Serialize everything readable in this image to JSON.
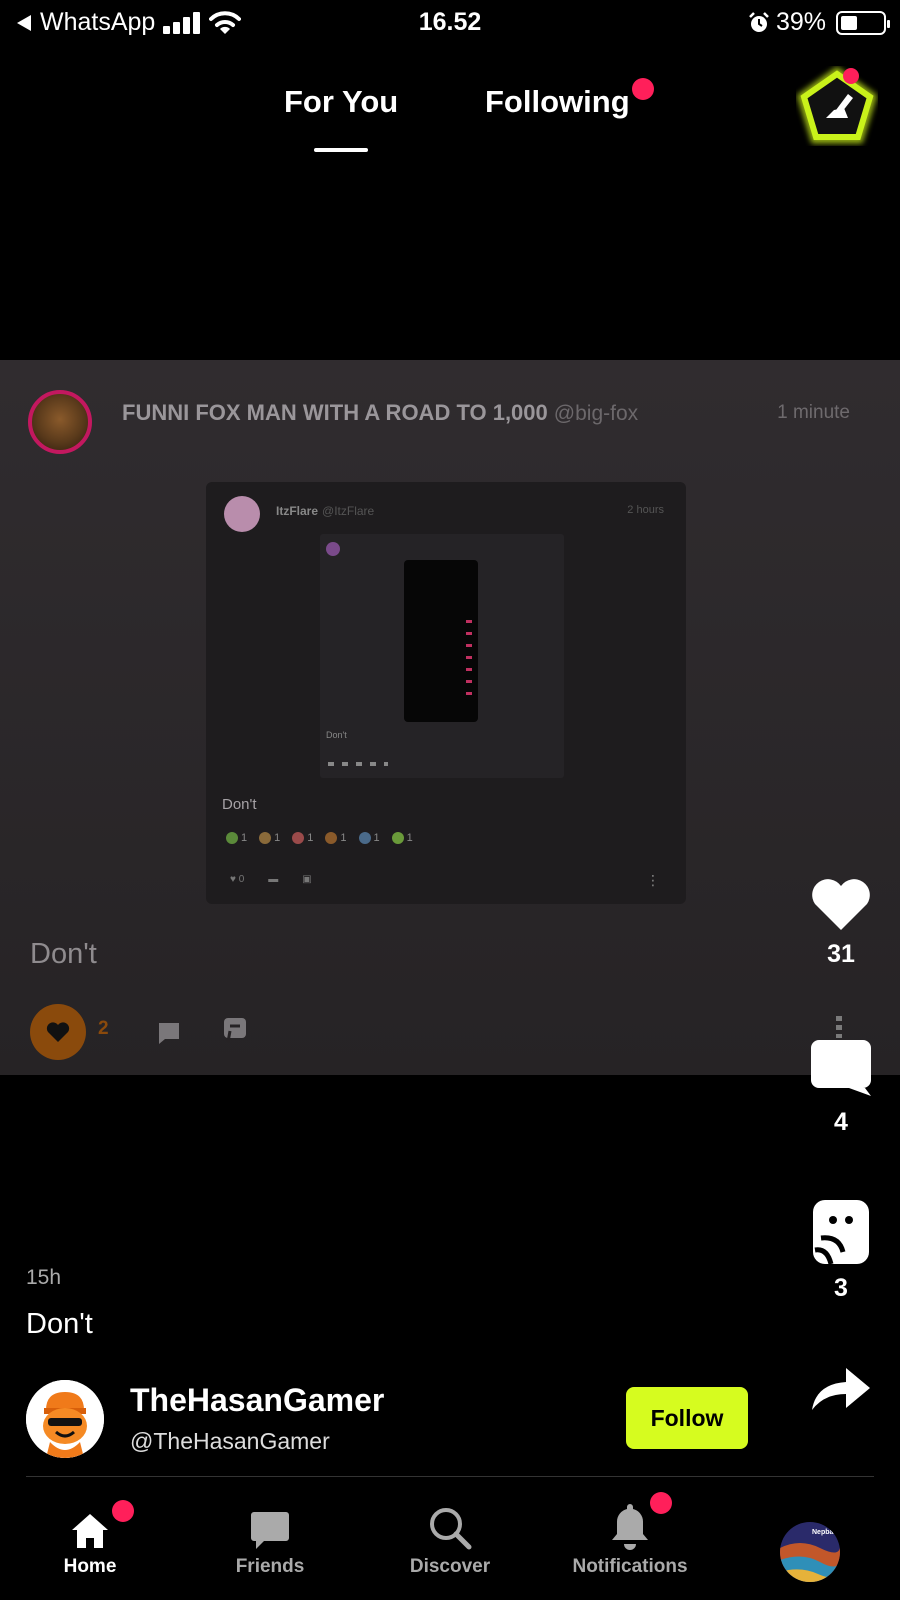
{
  "status_bar": {
    "back_app": "WhatsApp",
    "time": "16.52",
    "battery_percent": "39%",
    "battery_level": 0.39
  },
  "top_tabs": [
    {
      "label": "For You",
      "active": true
    },
    {
      "label": "Following",
      "active": false,
      "has_dot": true
    }
  ],
  "post_card": {
    "author_name": "FUNNI FOX MAN WITH A ROAD TO 1,000",
    "author_handle": "@big-fox",
    "time": "1 minute",
    "embedded": {
      "author_name": "ItzFlare",
      "author_handle": "@ItzFlare",
      "time": "2 hours",
      "inner_text": "Don't",
      "text": "Don't",
      "reactions": [
        {
          "count": "1",
          "color": "#5b8a3a"
        },
        {
          "count": "1",
          "color": "#8a6a3a"
        },
        {
          "count": "1",
          "color": "#9a4a4a"
        },
        {
          "count": "1",
          "color": "#8a5a2a"
        },
        {
          "count": "1",
          "color": "#4a6a8a"
        },
        {
          "count": "1",
          "color": "#6a9a3a"
        }
      ],
      "like_count": "0"
    },
    "text": "Don't",
    "like_count": "2"
  },
  "rail": {
    "likes": "31",
    "comments": "4",
    "reposts": "3"
  },
  "post": {
    "time": "15h",
    "caption": "Don't",
    "author_name": "TheHasanGamer",
    "author_handle": "@TheHasanGamer",
    "follow_label": "Follow"
  },
  "nav": {
    "items": [
      {
        "label": "Home",
        "icon": "home-icon",
        "active": true,
        "has_dot": true
      },
      {
        "label": "Friends",
        "icon": "chat-bubble-icon",
        "active": false
      },
      {
        "label": "Discover",
        "icon": "search-icon",
        "active": false
      },
      {
        "label": "Notifications",
        "icon": "bell-icon",
        "active": false,
        "has_dot": true
      }
    ],
    "profile_avatar_text": "Nepbar"
  },
  "colors": {
    "accent_lime": "#d6fc1f",
    "notification_dot": "#ff1f5a",
    "like_orange": "#8a4a0c"
  }
}
